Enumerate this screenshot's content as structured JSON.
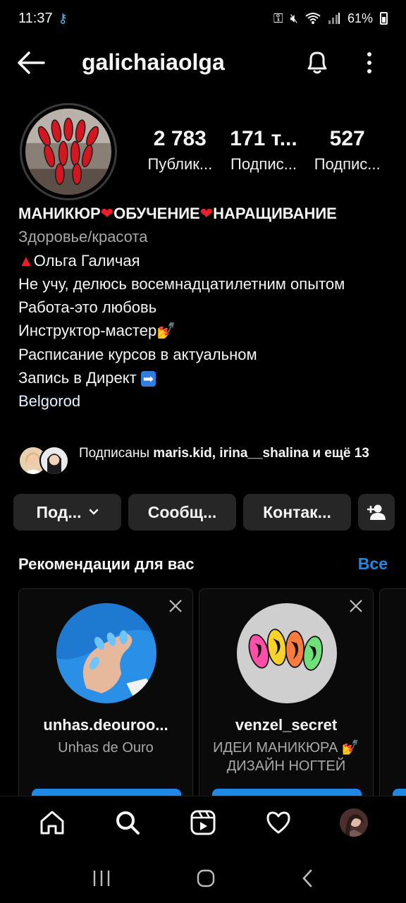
{
  "status_bar": {
    "time": "11:37",
    "battery": "61%"
  },
  "header": {
    "username": "galichaiaolga"
  },
  "stats": [
    {
      "value": "2 783",
      "label": "Публик..."
    },
    {
      "value": "171 т...",
      "label": "Подпис..."
    },
    {
      "value": "527",
      "label": "Подпис..."
    }
  ],
  "bio": {
    "name_part1": "МАНИКЮР",
    "name_part2": "ОБУЧЕНИЕ",
    "name_part3": "НАРАЩИВАНИЕ",
    "category": "Здоровье/красота",
    "lines": [
      "Ольга Галичая",
      "Не учу, делюсь восемнадцатилетним опытом",
      "Работа-это любовь",
      "Инструктор-мастер",
      "Расписание курсов в актуальном",
      "Запись в Директ"
    ],
    "location": "Belgorod"
  },
  "followed_by": {
    "prefix": "Подписаны",
    "user1": "maris.kid",
    "user2": "irina__shalina",
    "suffix": "и ещё 13"
  },
  "actions": {
    "subscribed": "Под...",
    "message": "Сообщ...",
    "contacts": "Контак..."
  },
  "recommendations": {
    "title": "Рекомендации для вас",
    "see_all": "Все",
    "cards": [
      {
        "username": "unhas.deouroo...",
        "subtitle": "Unhas de Ouro"
      },
      {
        "username": "venzel_secret",
        "subtitle": "ИДЕИ МАНИКЮРА 💅 ДИЗАЙН НОГТЕЙ"
      }
    ]
  },
  "icons": {
    "back": "arrow-left-icon",
    "bell": "bell-icon",
    "more": "more-vertical-icon",
    "home": "home-icon",
    "search": "search-icon",
    "reels": "reels-icon",
    "heart": "heart-icon",
    "add_user": "add-user-icon"
  },
  "colors": {
    "accent": "#1e88e5",
    "heart": "#ed1d2a",
    "background": "#000000"
  }
}
